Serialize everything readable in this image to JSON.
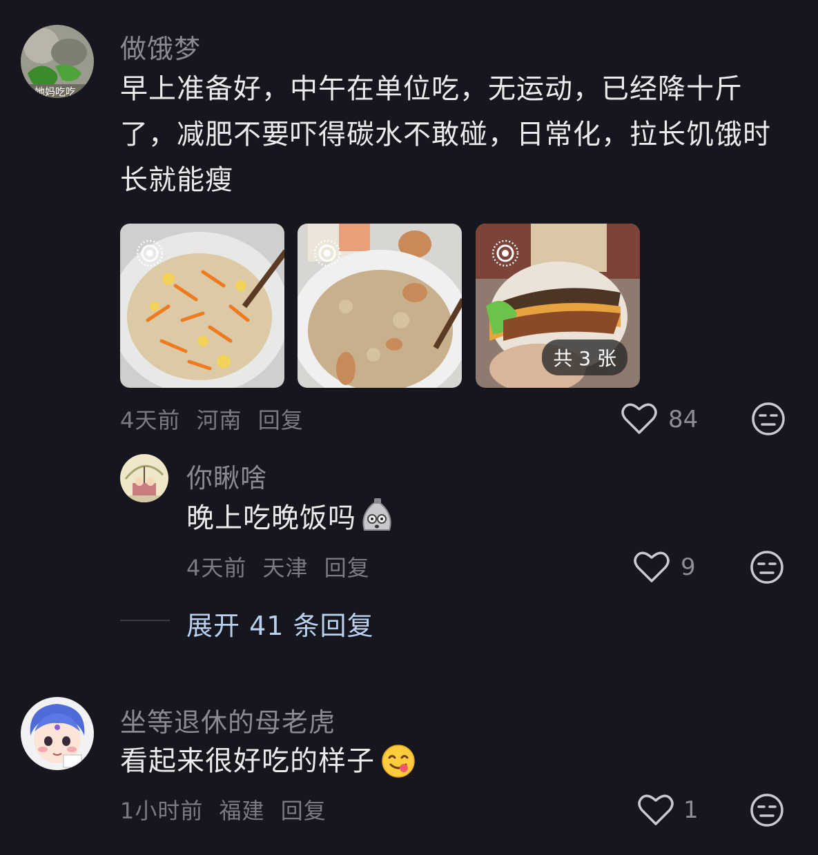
{
  "comments": [
    {
      "username": "做饿梦",
      "text": "早上准备好，中午在单位吃，无运动，已经降十斤了，减肥不要吓得碳水不敢碰，日常化，拉长饥饿时长就能瘦",
      "text_lines": [
        "早上准备好，中午在单位吃，无运动，已经降十斤",
        "了，减肥不要吓得碳水不敢碰，日常化，拉长饥饿时",
        "长就能瘦"
      ],
      "avatar_caption": "她妈吃吃",
      "images_total": "共 3 张",
      "time": "4天前",
      "location": "河南",
      "reply": "回复",
      "likes": "84",
      "reply_item": {
        "username": "你瞅啥",
        "text": "晚上吃晚饭吗",
        "time": "4天前",
        "location": "天津",
        "reply": "回复",
        "likes": "9"
      },
      "expand_label": "展开 41 条回复"
    },
    {
      "username": "坐等退休的母老虎",
      "text": "看起来很好吃的样子",
      "time": "1小时前",
      "location": "福建",
      "reply": "回复",
      "likes": "1"
    }
  ]
}
